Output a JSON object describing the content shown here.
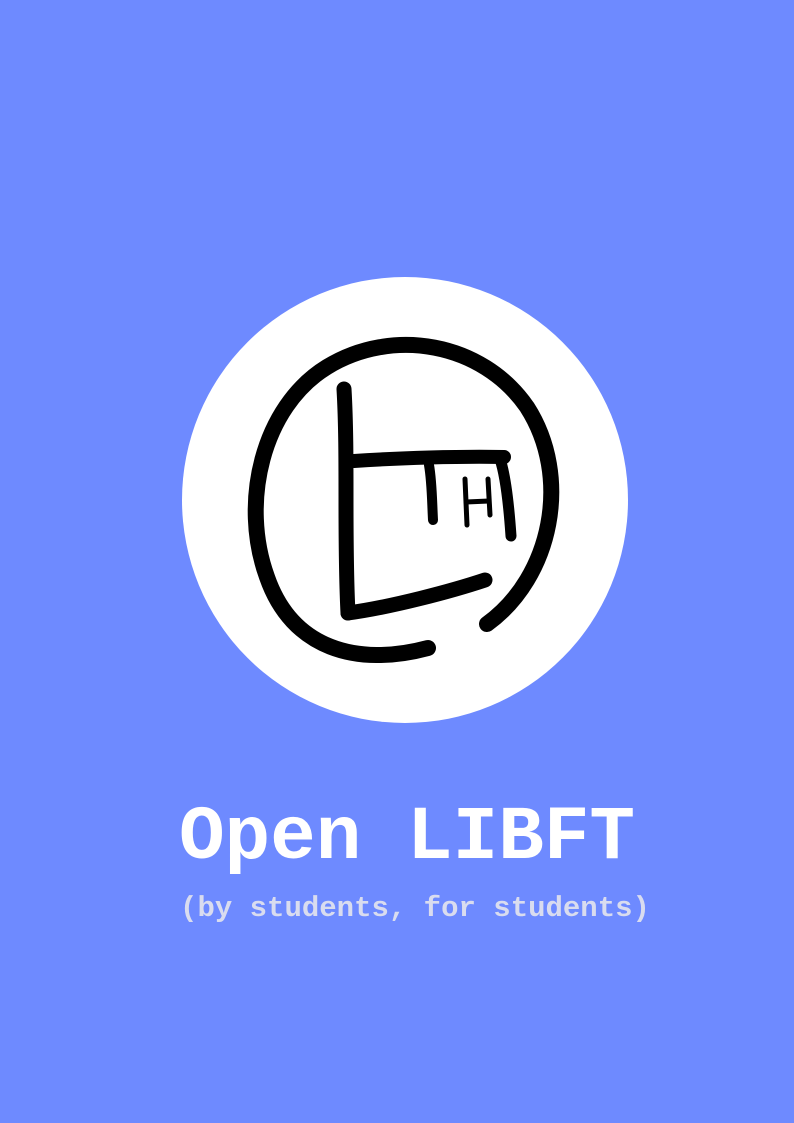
{
  "cover": {
    "title": "Open LIBFT",
    "subtitle": "(by students, for students)",
    "logo": {
      "icon": "lt-monogram-logo-icon",
      "text": "LTH"
    },
    "colors": {
      "background": "#6e8aff",
      "logo_disc": "#ffffff",
      "logo_stroke": "#000000",
      "title": "#ffffff",
      "subtitle": "#d9dcef"
    }
  }
}
